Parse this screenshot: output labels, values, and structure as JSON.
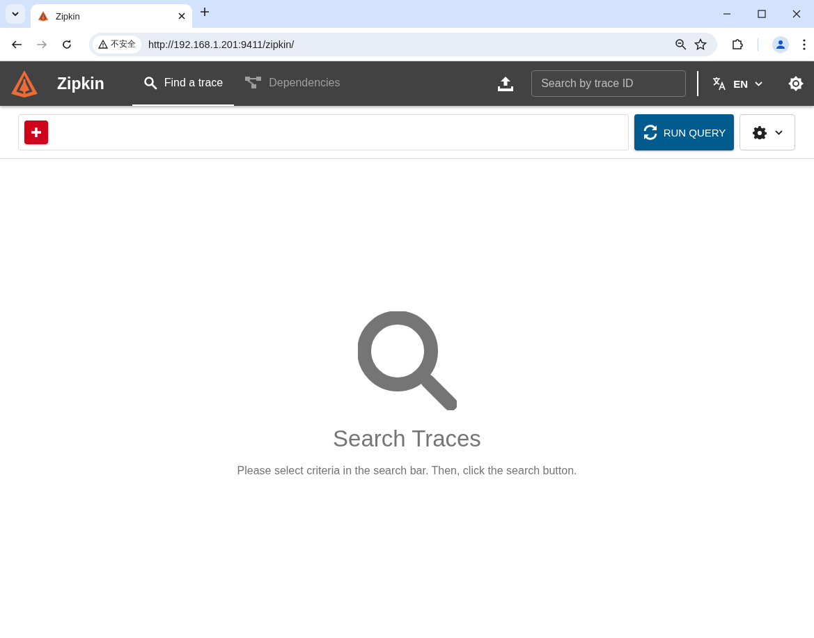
{
  "browser": {
    "tab": {
      "title": "Zipkin"
    },
    "address": {
      "security": "不安全",
      "url": "http://192.168.1.201:9411/zipkin/"
    }
  },
  "header": {
    "brand": "Zipkin",
    "nav": [
      {
        "label": "Find a trace",
        "kind": "search",
        "selected": true
      },
      {
        "label": "Dependencies",
        "kind": "dependencies",
        "selected": false
      }
    ],
    "trace_search": {
      "placeholder": "Search by trace ID"
    },
    "language": "EN"
  },
  "query": {
    "button": "RUN QUERY"
  },
  "empty_state": {
    "title": "Search Traces",
    "message": "Please select criteria in the search bar. Then, click the search button."
  }
}
